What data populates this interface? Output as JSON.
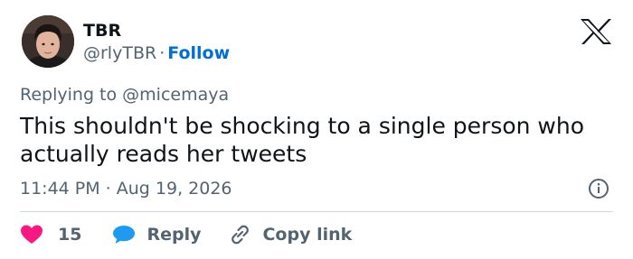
{
  "author": {
    "name": "TBR",
    "handle": "@rlyTBR",
    "separator": "·",
    "follow_label": "Follow"
  },
  "reply_context": {
    "text": "Replying to @micemaya"
  },
  "tweet": {
    "text": "This shouldn't be shocking to a single person who actually reads her tweets",
    "timestamp": "11:44 PM · Aug 19, 2026"
  },
  "actions": {
    "like_count": "15",
    "reply_label": "Reply",
    "copy_link_label": "Copy link"
  },
  "icons": {
    "brand": "x-logo-icon",
    "info": "info-icon",
    "like": "heart-icon",
    "reply": "speech-bubble-icon",
    "copy": "link-icon"
  },
  "colors": {
    "follow": "#006fd6",
    "heart": "#f91880",
    "reply_bubble": "#1d9bf0",
    "muted_text": "#536471",
    "main_text": "#0f1419",
    "divider": "#cfd9de"
  }
}
